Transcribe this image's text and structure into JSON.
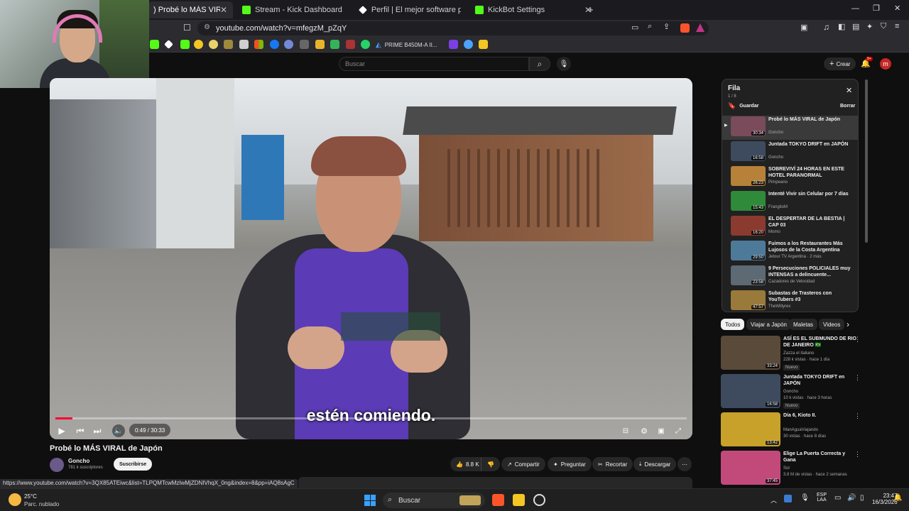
{
  "browser": {
    "tabs": [
      {
        "label": ") Probé lo MÁS VIRAL de Ja",
        "active": true
      },
      {
        "label": "Stream - Kick Dashboard",
        "active": false
      },
      {
        "label": "Perfil | El mejor software para potenc",
        "active": false
      },
      {
        "label": "KickBot Settings",
        "active": false
      }
    ],
    "new_tab": "+",
    "url": "youtube.com/watch?v=mfegzM_pZqY",
    "bookmark": "PRIME B450M-A II...",
    "status_url": "https://www.youtube.com/watch?v=3QX85ATEiwc&list=TLPQMTcwMzIwMjZDNIVhqX_0ng&index=8&pp=iAQ8sAgC"
  },
  "youtube": {
    "search_placeholder": "Buscar",
    "create_label": "Crear",
    "notif_count": "9+",
    "avatar_letter": "m"
  },
  "player": {
    "caption": "estén comiendo.",
    "time": "0:49 / 30:33",
    "progress_fraction": 0.027
  },
  "video_info": {
    "title": "Probé lo MÁS VIRAL de Japón",
    "channel": "Goncho",
    "subscribers": "781 k suscriptores",
    "subscribe_label": "Suscribirse",
    "likes": "8.8 K",
    "share_label": "Compartir",
    "ask_label": "Preguntar",
    "clip_label": "Recortar",
    "download_label": "Descargar"
  },
  "queue": {
    "title": "Fila",
    "position": "1 / 8",
    "save_label": "Guardar",
    "clear_label": "Borrar",
    "items": [
      {
        "title": "Probé lo MÁS VIRAL de Japón",
        "channel": "Goncho",
        "duration": "30:34",
        "color": "#7a4b5a"
      },
      {
        "title": "Juntada TOKYO DRIFT en JAPÓN",
        "channel": "Goncho",
        "duration": "16:58",
        "color": "#3e4a5e"
      },
      {
        "title": "SOBREVIVÍ 24 HORAS EN ESTE HOTEL PARANORMAL",
        "channel": "Pimpeano",
        "duration": "26:23",
        "color": "#b7813a"
      },
      {
        "title": "Intenté Vivir sin Celular por 7 días",
        "channel": "FrangitoM",
        "duration": "15:43",
        "color": "#2f8a3a"
      },
      {
        "title": "EL DESPERTAR DE LA BESTIA | CAP 03",
        "channel": "Momo",
        "duration": "16:20",
        "color": "#8a3a2f"
      },
      {
        "title": "Fuimos a los Restaurantes Más Lujosos de la Costa Argentina",
        "channel": "Jetour TV Argentina · 2 más",
        "duration": "29:50",
        "color": "#4e7a9a"
      },
      {
        "title": "9 Persecuciones POLICIALES muy INTENSAS a delincuente...",
        "channel": "Cazadores de Velocidad",
        "duration": "23:58",
        "color": "#5d6a73"
      },
      {
        "title": "Subastas de Trasteros con YouTubers #3",
        "channel": "TheWillyrex",
        "duration": "47:57",
        "color": "#9a7a3a"
      }
    ]
  },
  "chips": [
    "Todos",
    "Viajar a Japón",
    "Maletas",
    "Videos"
  ],
  "recommendations": [
    {
      "title": "ASÍ ES EL SUBMUNDO DE RIO DE JANEIRO 🇧🇷",
      "channel": "Zazza el italiano",
      "meta": "228 k vistas · hace 1 día",
      "badge": "Nuevo",
      "duration": "33:24",
      "color": "#5a4a3a"
    },
    {
      "title": "Juntada TOKYO DRIFT en JAPÓN",
      "channel": "Goncho",
      "meta": "10 k vistas · hace 3 horas",
      "badge": "Nuevo",
      "duration": "16:58",
      "color": "#3e4a5e"
    },
    {
      "title": "Día 6, Kioto II.",
      "channel": "ManAguaViajando",
      "meta": "30 vistas · hace 8 días",
      "badge": "",
      "duration": "13:42",
      "color": "#c8a12a"
    },
    {
      "title": "Elige La Puerta Correcta y Gana",
      "channel": "Sor",
      "meta": "3.8 M de vistas · hace 2 semanas",
      "badge": "",
      "duration": "37:45",
      "color": "#c24a7a"
    }
  ],
  "taskbar": {
    "weather_temp": "25°C",
    "weather_desc": "Parc. nublado",
    "search_label": "Buscar",
    "lang_top": "ESP",
    "lang_bottom": "LAA",
    "time": "23:47",
    "date": "16/3/2026"
  }
}
